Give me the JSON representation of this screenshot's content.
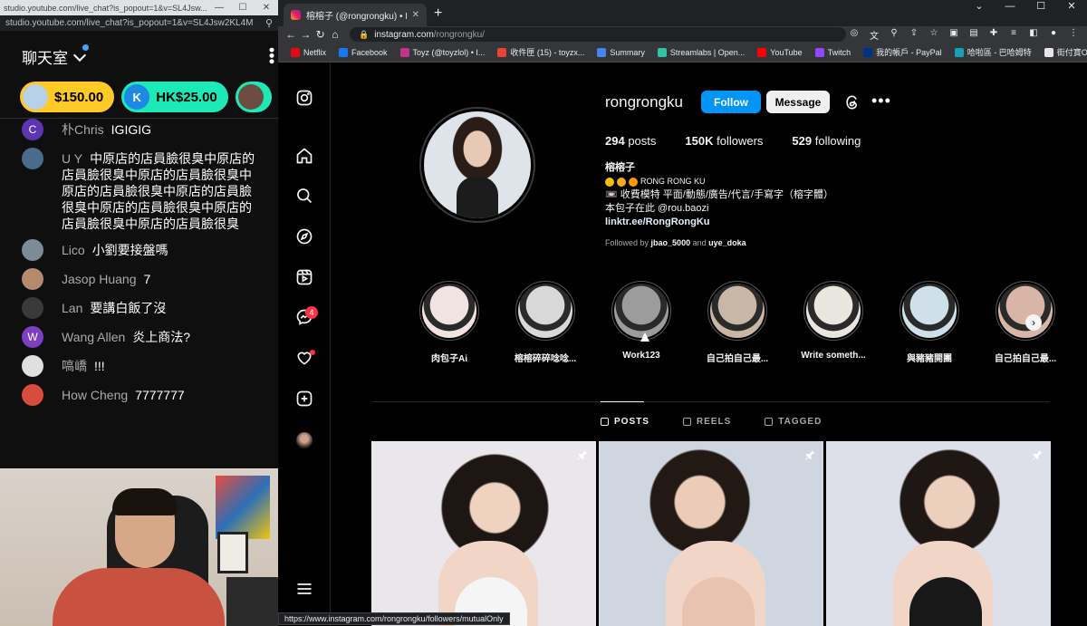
{
  "chat_window": {
    "titlebar": "studio.youtube.com/live_chat?is_popout=1&v=SL4Jsw...",
    "url": "studio.youtube.com/live_chat?is_popout=1&v=SL4Jsw2KL4M",
    "title": "聊天室",
    "superchats": [
      {
        "amount": "$150.00"
      },
      {
        "amount": "HK$25.00",
        "initial": "K"
      }
    ],
    "messages": [
      {
        "avatar": "C",
        "avatar_color": "#5e35b1",
        "name": "朴Chris",
        "text": "IGIGIG"
      },
      {
        "avatar": "",
        "avatar_color": "#4a6b8a",
        "name": "U Y",
        "text": "中原店的店員臉很臭中原店的店員臉很臭中原店的店員臉很臭中原店的店員臉很臭中原店的店員臉很臭中原店的店員臉很臭中原店的店員臉很臭中原店的店員臉很臭"
      },
      {
        "avatar": "",
        "avatar_color": "#7e8a96",
        "name": "Lico",
        "text": "小劉要接盤嗎"
      },
      {
        "avatar": "",
        "avatar_color": "#b38a6d",
        "name": "Jasop Huang",
        "text": "7"
      },
      {
        "avatar": "",
        "avatar_color": "#3a3a3a",
        "name": "Lan",
        "text": "要講白飯了沒"
      },
      {
        "avatar": "W",
        "avatar_color": "#7b3fbf",
        "name": "Wang Allen",
        "text": "炎上商法?"
      },
      {
        "avatar": "",
        "avatar_color": "#e0e0e0",
        "name": "嗃嶠",
        "text": "!!!"
      },
      {
        "avatar": "",
        "avatar_color": "#d84c3c",
        "name": "How Cheng",
        "text": "7777777"
      }
    ]
  },
  "browser": {
    "tab_title": "榕榕子 (@rongrongku) • Instag...",
    "url_host": "instagram.com",
    "url_path": "/rongrongku/",
    "bookmarks": [
      {
        "label": "Netflix",
        "color": "#e50914"
      },
      {
        "label": "Facebook",
        "color": "#1877f2"
      },
      {
        "label": "Toyz (@toyzlol) • I...",
        "color": "#c13584"
      },
      {
        "label": "收件匣 (15) - toyzx...",
        "color": "#ea4335"
      },
      {
        "label": "Summary",
        "color": "#4285f4"
      },
      {
        "label": "Streamlabs | Open...",
        "color": "#31c3a2"
      },
      {
        "label": "YouTube",
        "color": "#ff0000"
      },
      {
        "label": "Twitch",
        "color": "#9146ff"
      },
      {
        "label": "我的帳戶 - PayPal",
        "color": "#003087"
      },
      {
        "label": "哈啦區 - 巴哈姆特",
        "color": "#17a2b8"
      },
      {
        "label": "街付寶O'Pay電子支...",
        "color": "#e6e6e6"
      }
    ],
    "status_url": "https://www.instagram.com/rongrongku/followers/mutualOnly"
  },
  "profile": {
    "username": "rongrongku",
    "follow_label": "Follow",
    "message_label": "Message",
    "posts": "294",
    "posts_label": "posts",
    "followers": "150K",
    "followers_label": "followers",
    "following": "529",
    "following_label": "following",
    "display_name": "榕榕子",
    "bio_tag": "RONG RONG KU",
    "bio_line1": "📼 收費模特 平面/動態/廣告/代言/手寫字（榕字體）",
    "bio_line2": "本包子在此 @rou.baozi",
    "link": "linktr.ee/RongRongKu",
    "followed_by_prefix": "Followed by",
    "followed_by_1": "jbao_5000",
    "followed_by_and": "and",
    "followed_by_2": "uye_doka",
    "dm_badge": "4"
  },
  "highlights": [
    {
      "label": "肉包子Ai",
      "color": "#f1e3e0"
    },
    {
      "label": "榕榕碎碎唸唸...",
      "color": "#d8d8d8"
    },
    {
      "label": "Work123",
      "color": "#9c9c9c"
    },
    {
      "label": "自己拍自己最...",
      "color": "#c8b7a6"
    },
    {
      "label": "Write someth...",
      "color": "#e9e6e0"
    },
    {
      "label": "與豬豬開團",
      "color": "#cfe0ea"
    },
    {
      "label": "自己拍自己最...",
      "color": "#d9b5a8"
    }
  ],
  "tabs": [
    {
      "label": "POSTS",
      "active": true
    },
    {
      "label": "REELS",
      "active": false
    },
    {
      "label": "TAGGED",
      "active": false
    }
  ]
}
